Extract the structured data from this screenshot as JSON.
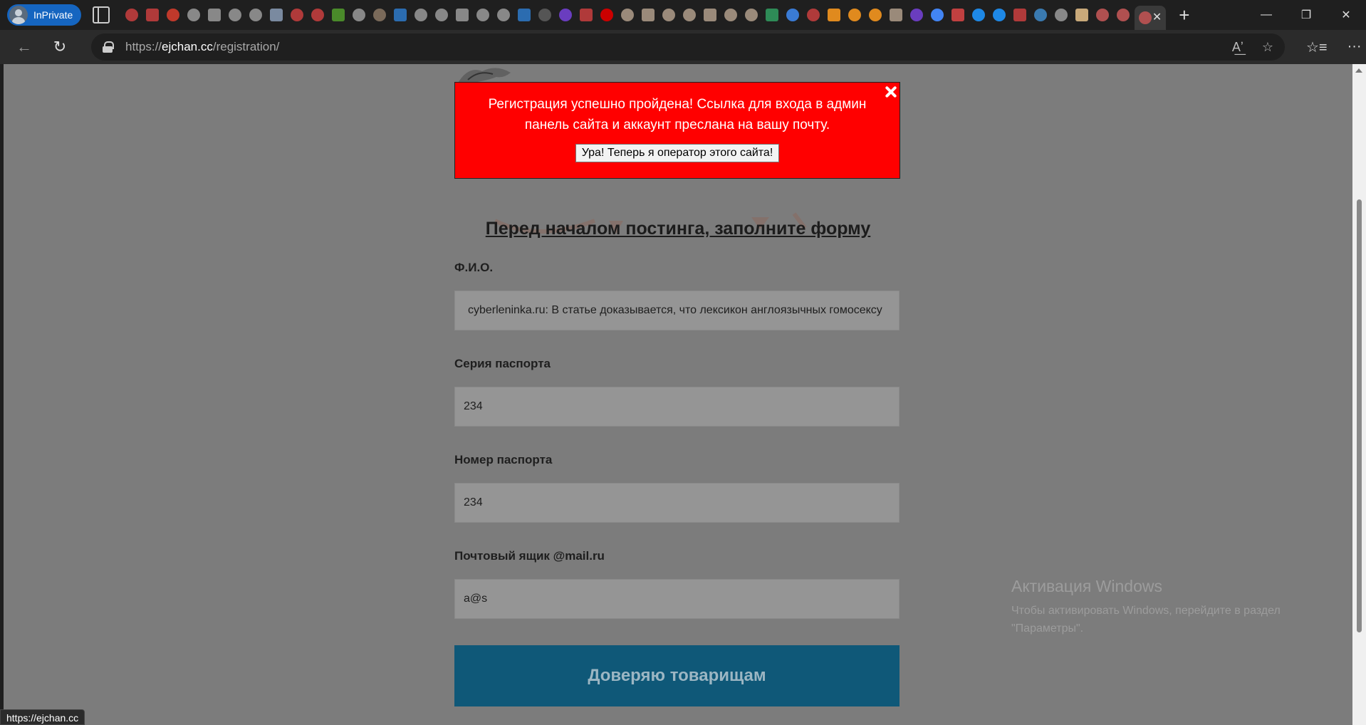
{
  "browser": {
    "inprivate_label": "InPrivate",
    "url_scheme": "https://",
    "url_host": "ejchan.cc",
    "url_path": "/registration/",
    "status_url": "https://ejchan.cc"
  },
  "favicon_colors": [
    "#b03a3a",
    "#b03a3a",
    "#c0392b",
    "#888888",
    "#888888",
    "#888888",
    "#888888",
    "#7a8aa0",
    "#b03a3a",
    "#b03a3a",
    "#4a8a2a",
    "#888888",
    "#7a6a5a",
    "#2b6cb0",
    "#888888",
    "#888888",
    "#888888",
    "#888888",
    "#888888",
    "#2b6cb0",
    "#555555",
    "#6a3dbf",
    "#b03a3a",
    "#cc0000",
    "#9a8a7a",
    "#9a8a7a",
    "#9a8a7a",
    "#9a8a7a",
    "#9a8a7a",
    "#9a8a7a",
    "#9a8a7a",
    "#2e8b57",
    "#3a7bd5",
    "#b03a3a",
    "#e08a1e",
    "#e08a1e",
    "#e08a1e",
    "#9a8a7a",
    "#6a3dbf",
    "#4285f4",
    "#c04040",
    "#1e88e5",
    "#1e88e5",
    "#b03a3a",
    "#3a7ab0",
    "#888888",
    "#c9a97a",
    "#b05050",
    "#b05050"
  ],
  "page": {
    "title": "Перед началом постинга, заполните форму",
    "fields": [
      {
        "label": "Ф.И.О.",
        "value": "cyberleninka.ru: В статье доказывается, что лексикон англоязычных гомосексу"
      },
      {
        "label": "Серия паспорта",
        "value": "234"
      },
      {
        "label": "Номер паспорта",
        "value": "234"
      },
      {
        "label": "Почтовый ящик @mail.ru",
        "value": "a@s"
      }
    ],
    "submit_label": "Доверяю товарищам"
  },
  "popup": {
    "message": "Регистрация успешно пройдена! Ссылка для входа в админ панель сайта и аккаунт преслана на вашу почту.",
    "button_label": "Ура! Теперь я оператор этого сайта!"
  },
  "windows_activation": {
    "title": "Активация Windows",
    "text": "Чтобы активировать Windows, перейдите в раздел \"Параметры\"."
  },
  "colors": {
    "popup_bg": "#ff0000",
    "submit_bg": "#0f5878",
    "overlay": "#7c7c7c"
  }
}
